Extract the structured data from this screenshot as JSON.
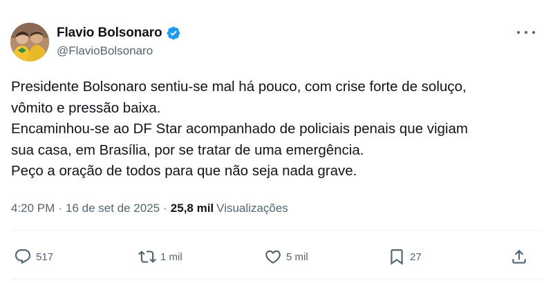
{
  "author": {
    "display_name": "Flavio Bolsonaro",
    "handle": "@FlavioBolsonaro",
    "verified": true,
    "verified_color": "#1d9bf0"
  },
  "tweet": {
    "lines": [
      "Presidente Bolsonaro sentiu-se mal há pouco, com crise forte de soluço,",
      "vômito e pressão baixa.",
      "Encaminhou-se ao DF Star acompanhado de policiais penais que vigiam",
      "sua casa, em Brasília, por se tratar de uma emergência.",
      "Peço a oração de todos para que não seja nada grave."
    ]
  },
  "meta": {
    "time": "4:20 PM",
    "separator": "·",
    "date": "16 de set de 2025",
    "views_count": "25,8 mil",
    "views_label": "Visualizações"
  },
  "actions": {
    "replies": "517",
    "reposts": "1 mil",
    "likes": "5 mil",
    "bookmarks": "27"
  },
  "icons": {
    "reply": "speech-bubble-icon",
    "repost": "repost-arrows-icon",
    "like": "heart-icon",
    "bookmark": "bookmark-icon",
    "share": "share-upload-icon",
    "more": "more-dots-icon"
  },
  "colors": {
    "text_primary": "#0f1419",
    "text_secondary": "#536471",
    "divider": "#eff3f4"
  }
}
